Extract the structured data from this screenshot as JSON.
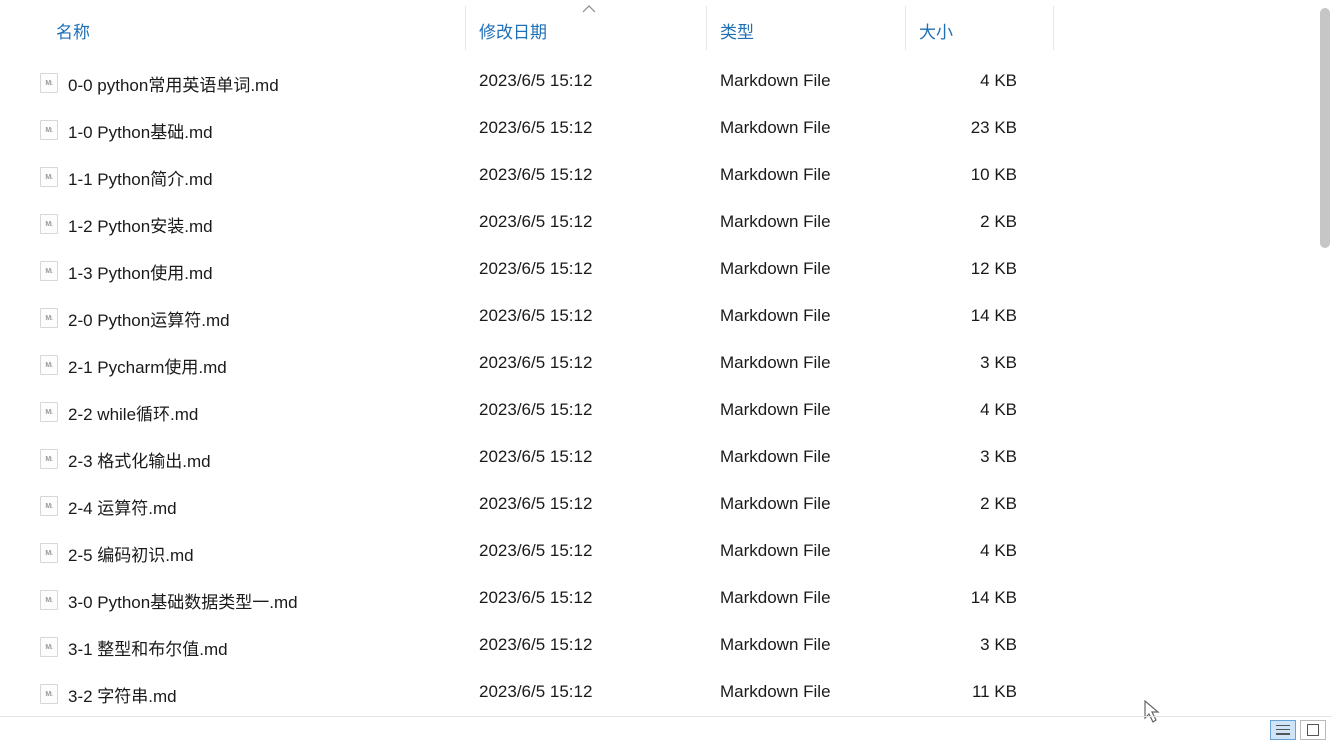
{
  "columns": {
    "name": "名称",
    "date": "修改日期",
    "type": "类型",
    "size": "大小"
  },
  "files": [
    {
      "name": "0-0 python常用英语单词.md",
      "date": "2023/6/5 15:12",
      "type": "Markdown File",
      "size": "4 KB"
    },
    {
      "name": "1-0 Python基础.md",
      "date": "2023/6/5 15:12",
      "type": "Markdown File",
      "size": "23 KB"
    },
    {
      "name": "1-1 Python简介.md",
      "date": "2023/6/5 15:12",
      "type": "Markdown File",
      "size": "10 KB"
    },
    {
      "name": "1-2 Python安装.md",
      "date": "2023/6/5 15:12",
      "type": "Markdown File",
      "size": "2 KB"
    },
    {
      "name": "1-3 Python使用.md",
      "date": "2023/6/5 15:12",
      "type": "Markdown File",
      "size": "12 KB"
    },
    {
      "name": "2-0 Python运算符.md",
      "date": "2023/6/5 15:12",
      "type": "Markdown File",
      "size": "14 KB"
    },
    {
      "name": "2-1 Pycharm使用.md",
      "date": "2023/6/5 15:12",
      "type": "Markdown File",
      "size": "3 KB"
    },
    {
      "name": "2-2 while循环.md",
      "date": "2023/6/5 15:12",
      "type": "Markdown File",
      "size": "4 KB"
    },
    {
      "name": "2-3 格式化输出.md",
      "date": "2023/6/5 15:12",
      "type": "Markdown File",
      "size": "3 KB"
    },
    {
      "name": "2-4 运算符.md",
      "date": "2023/6/5 15:12",
      "type": "Markdown File",
      "size": "2 KB"
    },
    {
      "name": "2-5 编码初识.md",
      "date": "2023/6/5 15:12",
      "type": "Markdown File",
      "size": "4 KB"
    },
    {
      "name": "3-0 Python基础数据类型一.md",
      "date": "2023/6/5 15:12",
      "type": "Markdown File",
      "size": "14 KB"
    },
    {
      "name": "3-1 整型和布尔值.md",
      "date": "2023/6/5 15:12",
      "type": "Markdown File",
      "size": "3 KB"
    },
    {
      "name": "3-2 字符串.md",
      "date": "2023/6/5 15:12",
      "type": "Markdown File",
      "size": "11 KB"
    }
  ]
}
